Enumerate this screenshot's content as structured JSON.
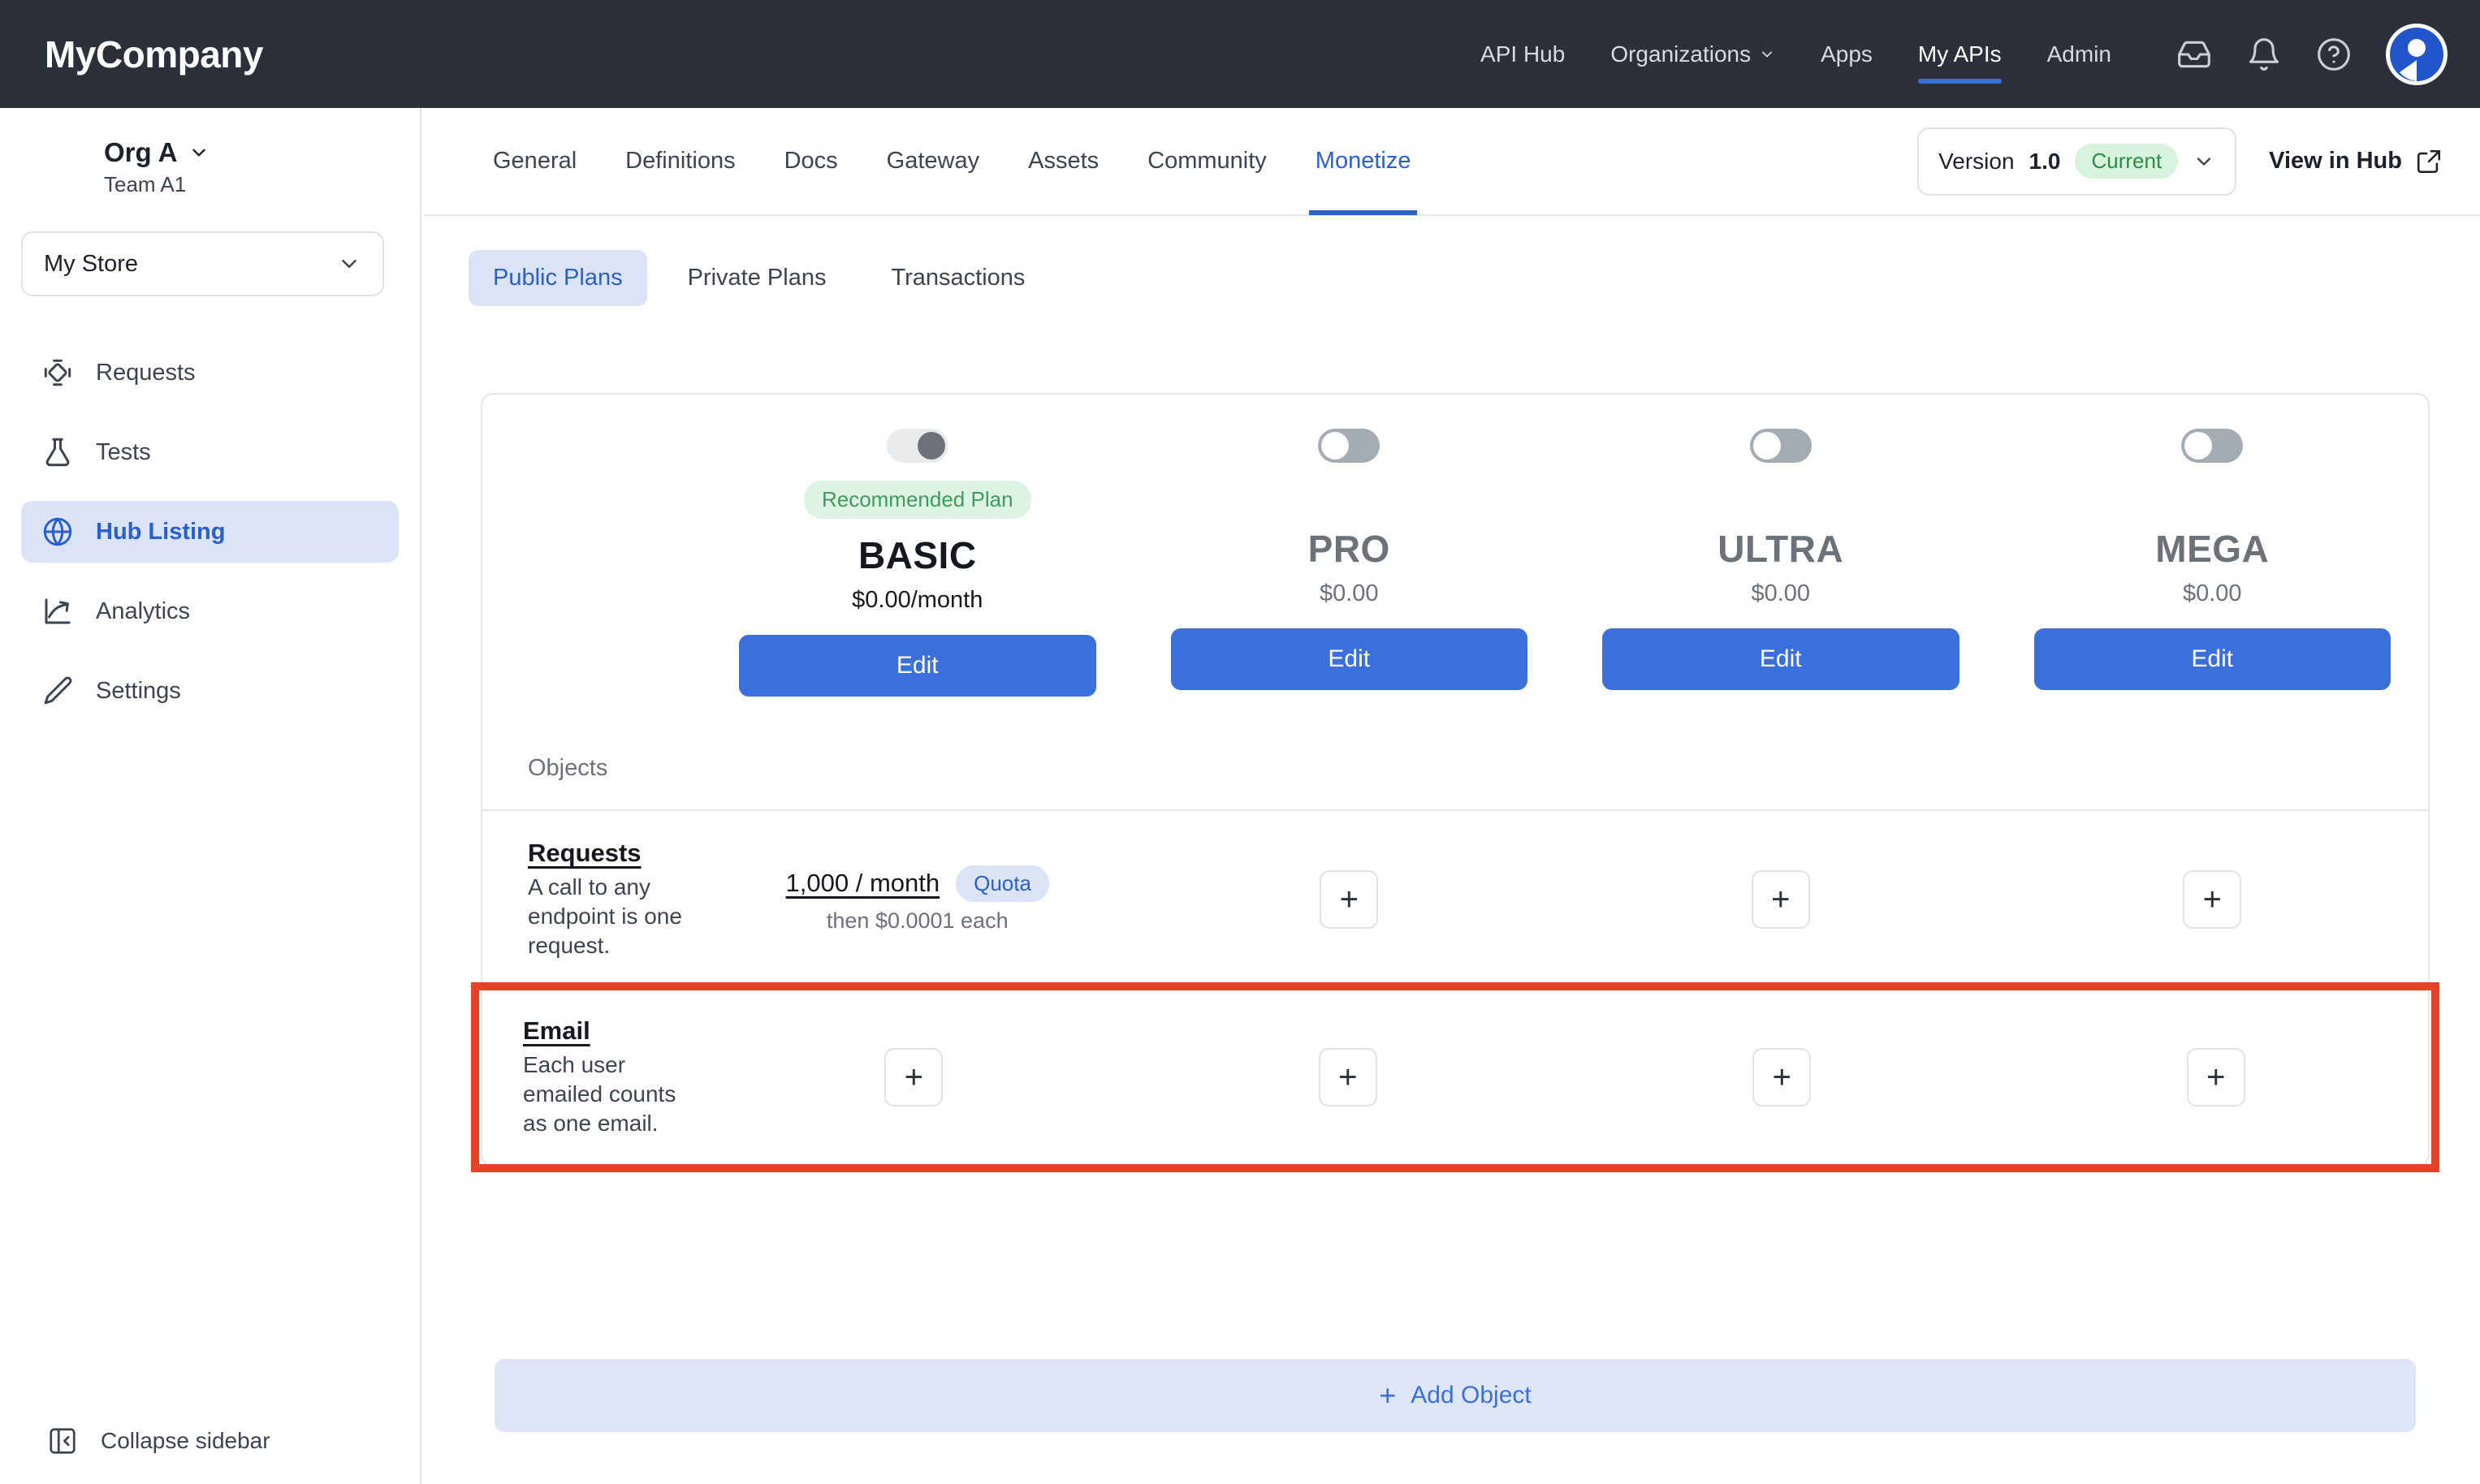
{
  "topbar": {
    "brand": "MyCompany",
    "nav": [
      {
        "label": "API Hub",
        "active": false,
        "caret": false
      },
      {
        "label": "Organizations",
        "active": false,
        "caret": true
      },
      {
        "label": "Apps",
        "active": false,
        "caret": false
      },
      {
        "label": "My APIs",
        "active": true,
        "caret": false
      },
      {
        "label": "Admin",
        "active": false,
        "caret": false
      }
    ],
    "icons": [
      "inbox-icon",
      "bell-icon",
      "help-icon"
    ],
    "avatar": "user-avatar"
  },
  "sidebar": {
    "org_name": "Org A",
    "org_team": "Team A1",
    "store_value": "My Store",
    "items": [
      {
        "label": "Requests",
        "icon": "requests-icon",
        "active": false
      },
      {
        "label": "Tests",
        "icon": "flask-icon",
        "active": false
      },
      {
        "label": "Hub Listing",
        "icon": "globe-icon",
        "active": true
      },
      {
        "label": "Analytics",
        "icon": "analytics-icon",
        "active": false
      },
      {
        "label": "Settings",
        "icon": "pencil-icon",
        "active": false
      }
    ],
    "collapse_label": "Collapse sidebar",
    "collapse_icon": "collapse-sidebar-icon"
  },
  "content_tabs": [
    {
      "label": "General",
      "active": false
    },
    {
      "label": "Definitions",
      "active": false
    },
    {
      "label": "Docs",
      "active": false
    },
    {
      "label": "Gateway",
      "active": false
    },
    {
      "label": "Assets",
      "active": false
    },
    {
      "label": "Community",
      "active": false
    },
    {
      "label": "Monetize",
      "active": true
    }
  ],
  "version": {
    "prefix": "Version",
    "number": "1.0",
    "badge": "Current",
    "caret_icon": "chevron-down-icon"
  },
  "view_in_hub": {
    "label": "View in Hub",
    "icon": "external-link-icon"
  },
  "plan_tabs": [
    {
      "label": "Public Plans",
      "active": true
    },
    {
      "label": "Private Plans",
      "active": false
    },
    {
      "label": "Transactions",
      "active": false
    }
  ],
  "plans": [
    {
      "name": "BASIC",
      "price": "$0.00/month",
      "badge": "Recommended Plan",
      "toggle_state": "on",
      "edit_label": "Edit",
      "muted": false
    },
    {
      "name": "PRO",
      "price": "$0.00",
      "badge": "",
      "toggle_state": "off",
      "edit_label": "Edit",
      "muted": true
    },
    {
      "name": "ULTRA",
      "price": "$0.00",
      "badge": "",
      "toggle_state": "off",
      "edit_label": "Edit",
      "muted": true
    },
    {
      "name": "MEGA",
      "price": "$0.00",
      "badge": "",
      "toggle_state": "off",
      "edit_label": "Edit",
      "muted": true
    }
  ],
  "objects_label": "Objects",
  "objects": [
    {
      "title": "Requests",
      "description": "A call to any endpoint is one request.",
      "highlighted": false,
      "cells": [
        {
          "type": "quota",
          "value": "1,000 / month",
          "pill": "Quota",
          "sub": "then $0.0001 each"
        },
        {
          "type": "add",
          "label": "+"
        },
        {
          "type": "add",
          "label": "+"
        },
        {
          "type": "add",
          "label": "+"
        }
      ]
    },
    {
      "title": "Email",
      "description": "Each user emailed counts as one email.",
      "highlighted": true,
      "cells": [
        {
          "type": "add",
          "label": "+"
        },
        {
          "type": "add",
          "label": "+"
        },
        {
          "type": "add",
          "label": "+"
        },
        {
          "type": "add",
          "label": "+"
        }
      ]
    }
  ],
  "add_object": {
    "label": "Add Object",
    "icon": "plus-icon"
  },
  "colors": {
    "topbar_bg": "#2b303b",
    "accent_blue": "#3b6fdb",
    "link_blue": "#2b5fcb",
    "highlight_red": "#e8412a",
    "badge_green_text": "#3f9a60",
    "badge_green_bg": "#dff3e5"
  }
}
